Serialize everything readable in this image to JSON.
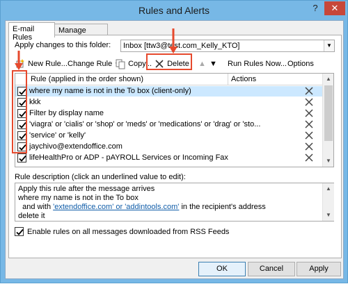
{
  "window": {
    "title": "Rules and Alerts",
    "help": "?",
    "close": "✕"
  },
  "tabs": [
    {
      "label": "E-mail Rules",
      "active": true
    },
    {
      "label": "Manage Alerts",
      "active": false
    }
  ],
  "folder": {
    "label": "Apply changes to this folder:",
    "value": "Inbox [ttw3@test.com_Kelly_KTO]"
  },
  "toolbar": {
    "new_rule": "New Rule...",
    "change_rule": "Change Rule",
    "copy": "Copy...",
    "delete": "Delete",
    "run_rules": "Run Rules Now...",
    "options": "Options"
  },
  "rules_list": {
    "col_rule": "Rule (applied in the order shown)",
    "col_actions": "Actions",
    "rows": [
      {
        "name": "where my name is not in the To box  (client-only)",
        "checked": true,
        "selected": true
      },
      {
        "name": "kkk",
        "checked": true,
        "selected": false
      },
      {
        "name": "Filter by display name",
        "checked": true,
        "selected": false
      },
      {
        "name": "'viagra' or 'cialis' or 'shop' or 'meds' or 'medications' or 'drag' or 'sto...",
        "checked": true,
        "selected": false
      },
      {
        "name": "'service' or 'kelly'",
        "checked": true,
        "selected": false
      },
      {
        "name": "jaychivo@extendoffice.com",
        "checked": true,
        "selected": false
      },
      {
        "name": "lifeHealthPro or ADP - pAYROLL Services or Incoming Fax",
        "checked": true,
        "selected": false
      }
    ]
  },
  "description": {
    "label": "Rule description (click an underlined value to edit):",
    "line1": "Apply this rule after the message arrives",
    "line2": "where my name is not in the To box",
    "line3_pre": "  and with ",
    "line3_link": "'extendoffice.com' or 'addintools.com'",
    "line3_post": " in the recipient's address",
    "line4": "delete it"
  },
  "rss": {
    "label": "Enable rules on all messages downloaded from RSS Feeds",
    "checked": true
  },
  "buttons": {
    "ok": "OK",
    "cancel": "Cancel",
    "apply": "Apply"
  },
  "colors": {
    "frame": "#77b8e6",
    "close": "#c7473a",
    "annotation": "#e6492d",
    "selection": "#cce8ff",
    "link": "#0f5ca8"
  }
}
